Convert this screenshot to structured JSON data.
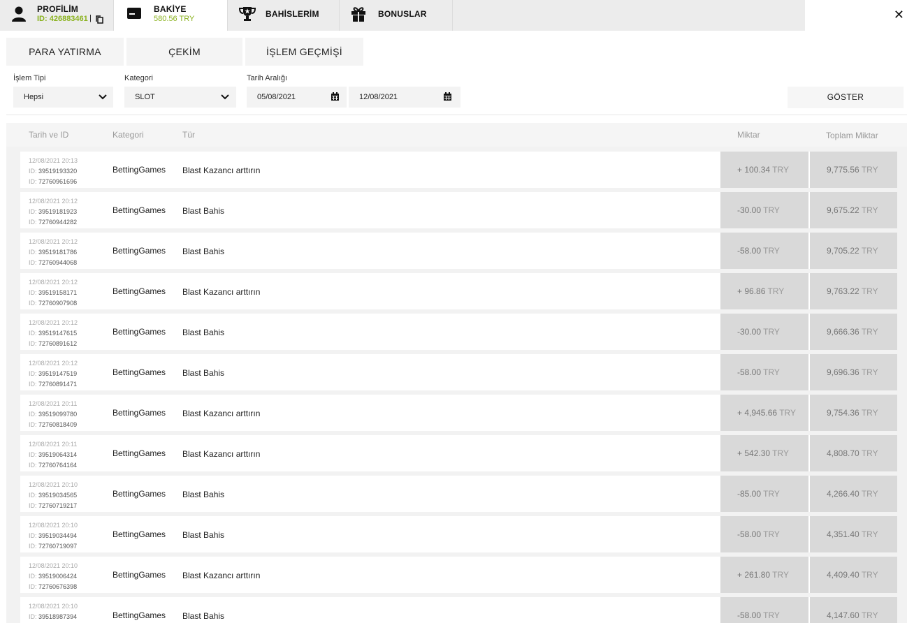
{
  "nav": {
    "profil": {
      "title": "PROFİLİM",
      "id": "ID: 426883461",
      "icon": "user-icon"
    },
    "bakiye": {
      "title": "BAKİYE",
      "amount": "580.56 TRY",
      "icon": "wallet-icon"
    },
    "bahislerim": {
      "title": "BAHİSLERİM",
      "icon": "trophy-icon"
    },
    "bonuslar": {
      "title": "BONUSLAR",
      "icon": "gift-icon"
    },
    "close": "✕"
  },
  "subtabs": {
    "para": "PARA YATIRMA",
    "cekim": "ÇEKİM",
    "islem": "İŞLEM GEÇMİŞİ"
  },
  "filters": {
    "islem_tipi": {
      "label": "İşlem Tipi",
      "value": "Hepsi"
    },
    "kategori": {
      "label": "Kategori",
      "value": "SLOT"
    },
    "tarih": {
      "label": "Tarih Aralığı",
      "from": "05/08/2021",
      "to": "12/08/2021"
    },
    "show_button": "GÖSTER"
  },
  "table": {
    "headers": {
      "date": "Tarih ve ID",
      "kategori": "Kategori",
      "tur": "Tür",
      "miktar": "Miktar",
      "toplam": "Toplam Miktar"
    },
    "id_prefix": "ID: ",
    "currency": "TRY",
    "rows": [
      {
        "date": "12/08/2021 20:13",
        "id1": "39519193320",
        "id2": "72760961696",
        "kategori": "BettingGames",
        "tur": "Blast Kazancı arttırın",
        "miktar": "+ 100.34",
        "toplam": "9,775.56"
      },
      {
        "date": "12/08/2021 20:12",
        "id1": "39519181923",
        "id2": "72760944282",
        "kategori": "BettingGames",
        "tur": "Blast Bahis",
        "miktar": "-30.00",
        "toplam": "9,675.22"
      },
      {
        "date": "12/08/2021 20:12",
        "id1": "39519181786",
        "id2": "72760944068",
        "kategori": "BettingGames",
        "tur": "Blast Bahis",
        "miktar": "-58.00",
        "toplam": "9,705.22"
      },
      {
        "date": "12/08/2021 20:12",
        "id1": "39519158171",
        "id2": "72760907908",
        "kategori": "BettingGames",
        "tur": "Blast Kazancı arttırın",
        "miktar": "+ 96.86",
        "toplam": "9,763.22"
      },
      {
        "date": "12/08/2021 20:12",
        "id1": "39519147615",
        "id2": "72760891612",
        "kategori": "BettingGames",
        "tur": "Blast Bahis",
        "miktar": "-30.00",
        "toplam": "9,666.36"
      },
      {
        "date": "12/08/2021 20:12",
        "id1": "39519147519",
        "id2": "72760891471",
        "kategori": "BettingGames",
        "tur": "Blast Bahis",
        "miktar": "-58.00",
        "toplam": "9,696.36"
      },
      {
        "date": "12/08/2021 20:11",
        "id1": "39519099780",
        "id2": "72760818409",
        "kategori": "BettingGames",
        "tur": "Blast Kazancı arttırın",
        "miktar": "+ 4,945.66",
        "toplam": "9,754.36"
      },
      {
        "date": "12/08/2021 20:11",
        "id1": "39519064314",
        "id2": "72760764164",
        "kategori": "BettingGames",
        "tur": "Blast Kazancı arttırın",
        "miktar": "+ 542.30",
        "toplam": "4,808.70"
      },
      {
        "date": "12/08/2021 20:10",
        "id1": "39519034565",
        "id2": "72760719217",
        "kategori": "BettingGames",
        "tur": "Blast Bahis",
        "miktar": "-85.00",
        "toplam": "4,266.40"
      },
      {
        "date": "12/08/2021 20:10",
        "id1": "39519034494",
        "id2": "72760719097",
        "kategori": "BettingGames",
        "tur": "Blast Bahis",
        "miktar": "-58.00",
        "toplam": "4,351.40"
      },
      {
        "date": "12/08/2021 20:10",
        "id1": "39519006424",
        "id2": "72760676398",
        "kategori": "BettingGames",
        "tur": "Blast Kazancı arttırın",
        "miktar": "+ 261.80",
        "toplam": "4,409.40"
      },
      {
        "date": "12/08/2021 20:10",
        "id1": "39518987394",
        "id2": "",
        "kategori": "BettingGames",
        "tur": "Blast Bahis",
        "miktar": "-58.00",
        "toplam": "4,147.60"
      }
    ]
  },
  "colors": {
    "accent": "#8ab21e",
    "nav_bg": "#ececec",
    "amount_cell": "#d9d9d9"
  }
}
